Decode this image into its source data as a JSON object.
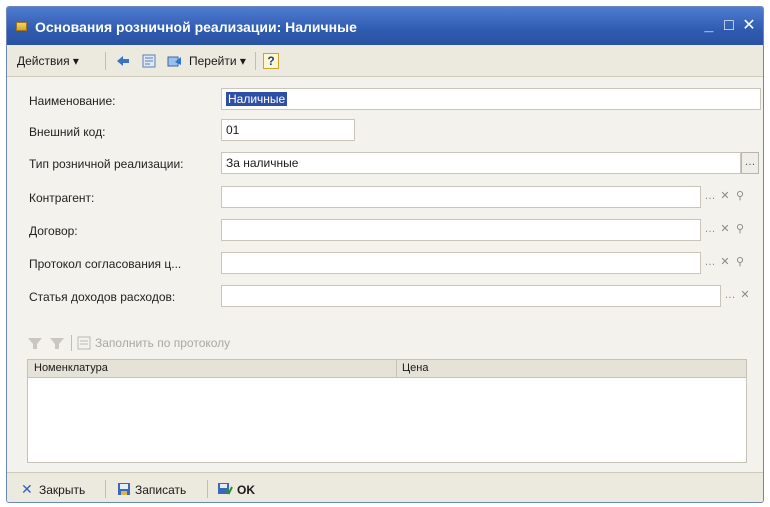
{
  "window": {
    "title": "Основания розничной реализации: Наличные"
  },
  "toolbar": {
    "actions_label": "Действия ▾",
    "goto_label": "Перейти ▾",
    "help_label": "?"
  },
  "form": {
    "name_label": "Наименование:",
    "name_value": "Наличные",
    "code_label": "Внешний код:",
    "code_value": "01",
    "type_label": "Тип розничной реализации:",
    "type_value": "За наличные",
    "counterparty_label": "Контрагент:",
    "contract_label": "Договор:",
    "protocol_label": "Протокол согласования ц...",
    "article_label": "Статья доходов расходов:"
  },
  "table": {
    "fill_by_protocol_label": "Заполнить по протоколу",
    "columns": [
      "Номенклатура",
      "Цена"
    ]
  },
  "footer": {
    "close_label": "Закрыть",
    "save_label": "Записать",
    "ok_label": "OK"
  },
  "colors": {
    "titlebar": "#2f5bb0",
    "selection": "#2f4fa6"
  }
}
